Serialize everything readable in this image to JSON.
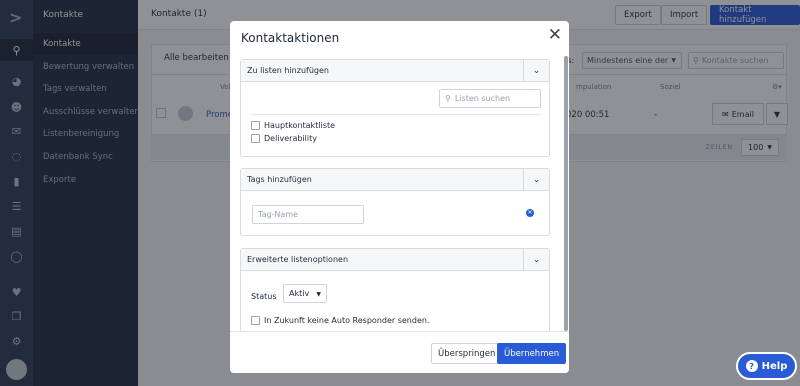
{
  "rail": {
    "icons": [
      "logo-icon",
      "search-icon",
      "dashboard-icon",
      "contacts-icon",
      "mail-icon",
      "automation-icon",
      "chat-icon",
      "lists-icon",
      "forms-icon",
      "globe-icon",
      "heart-icon",
      "pages-icon",
      "gear-icon",
      "avatar-icon"
    ]
  },
  "nav": {
    "title": "Kontakte",
    "items": [
      {
        "label": "Kontakte",
        "active": true
      },
      {
        "label": "Bewertung verwalten"
      },
      {
        "label": "Tags verwalten"
      },
      {
        "label": "Ausschlüsse verwalten"
      },
      {
        "label": "Listenbereinigung"
      },
      {
        "label": "Datenbank Sync"
      },
      {
        "label": "Exporte"
      }
    ]
  },
  "page": {
    "title": "Kontakte (1)",
    "export_label": "Export",
    "import_label": "Import",
    "add_contact_label": "Kontakt hinzufügen",
    "bulk_edit_label": "Alle bearbeiten",
    "filter_value": "Mindestens eine der",
    "filter_prefix": "rs:",
    "contact_search_placeholder": "Kontakte suchen",
    "headers": [
      "Vollstä",
      "mpulation",
      "Soziel"
    ],
    "row": {
      "name": "Prome",
      "date": "020 00:51",
      "social": "-",
      "email_label": "Email"
    },
    "rows_label": "ZEILEN",
    "per_page": "100"
  },
  "modal": {
    "title": "Kontaktaktionen",
    "sections": {
      "lists": {
        "title": "Zu listen hinzufügen",
        "search_placeholder": "Listen suchen",
        "options": [
          "Hauptkontaktliste",
          "Deliverability"
        ]
      },
      "tags": {
        "title": "Tags hinzufügen",
        "tag_placeholder": "Tag-Name"
      },
      "advanced": {
        "title": "Erweiterte listenoptionen",
        "status_label": "Status",
        "status_value": "Aktiv",
        "options": [
          "In Zukunft keine Auto Responder senden."
        ]
      }
    },
    "skip_label": "Überspringen",
    "apply_label": "Übernehmen"
  },
  "help": {
    "label": "Help"
  }
}
